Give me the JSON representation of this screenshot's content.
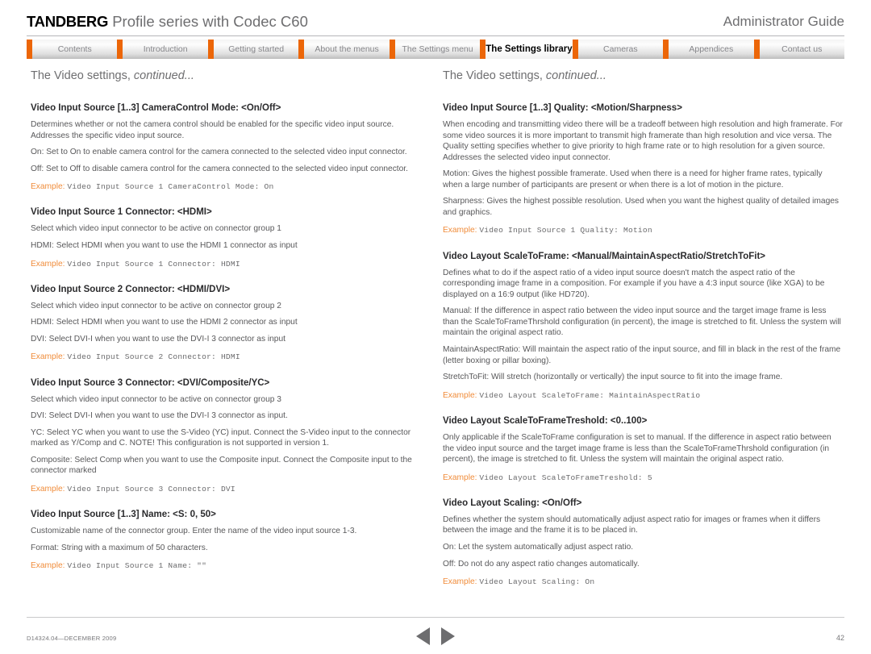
{
  "header": {
    "brand": "TANDBERG",
    "product": "Profile series with Codec C60",
    "guide_title": "Administrator Guide",
    "accent_color": "#ec6608"
  },
  "tabs": [
    {
      "label": "Contents",
      "active": false
    },
    {
      "label": "Introduction",
      "active": false
    },
    {
      "label": "Getting started",
      "active": false
    },
    {
      "label": "About the menus",
      "active": false
    },
    {
      "label": "The Settings menu",
      "active": false
    },
    {
      "label": "The Settings library",
      "active": true
    },
    {
      "label": "Cameras",
      "active": false
    },
    {
      "label": "Appendices",
      "active": false
    },
    {
      "label": "Contact us",
      "active": false
    }
  ],
  "left_column": {
    "title_main": "The Video settings,",
    "title_cont": "continued...",
    "sections": [
      {
        "heading": "Video Input Source [1..3] CameraControl Mode: <On/Off>",
        "paragraphs": [
          "Determines whether or not the camera control should be enabled for the specific video input source. Addresses the specific video input source.",
          "On: Set to On to enable camera control for the camera connected to the selected video input connector.",
          "Off: Set to Off to disable camera control for the camera connected to the selected video input connector."
        ],
        "example_label": "Example:",
        "example_code": "Video Input Source 1 CameraControl Mode: On"
      },
      {
        "heading": "Video Input Source 1 Connector: <HDMI>",
        "paragraphs": [
          "Select which video input connector to be active on connector group 1",
          "HDMI: Select HDMI when you want to use the HDMI 1 connector as input"
        ],
        "example_label": "Example:",
        "example_code": "Video Input Source 1 Connector: HDMI"
      },
      {
        "heading": "Video Input Source 2 Connector: <HDMI/DVI>",
        "paragraphs": [
          "Select which video input connector to be active on connector group 2",
          "HDMI: Select HDMI when you want to use the HDMI 2 connector as input",
          "DVI: Select DVI-I when you want to use the DVI-I 3 connector as input"
        ],
        "example_label": "Example:",
        "example_code": "Video Input Source 2 Connector: HDMI"
      },
      {
        "heading": "Video Input Source 3 Connector: <DVI/Composite/YC>",
        "paragraphs": [
          "Select which video input connector to be active on connector group 3",
          "DVI: Select DVI-I when you want to use the DVI-I 3 connector as input.",
          "YC: Select YC when you want to use the S-Video (YC) input. Connect the S-Video input to the connector marked as Y/Comp and C. NOTE! This configuration is not supported in version 1.",
          "Composite: Select Comp when you want to use the Composite input. Connect the Composite input to the connector marked"
        ],
        "example_label": "Example:",
        "example_code": "Video Input Source 3 Connector: DVI"
      },
      {
        "heading": "Video Input Source [1..3] Name: <S: 0, 50>",
        "paragraphs": [
          "Customizable name of the connector group. Enter the name of the video input source 1-3.",
          "Format: String with a maximum of 50 characters."
        ],
        "example_label": "Example:",
        "example_code": "Video Input Source 1 Name: \"\""
      }
    ]
  },
  "right_column": {
    "title_main": "The Video settings,",
    "title_cont": "continued...",
    "sections": [
      {
        "heading": "Video Input Source [1..3] Quality: <Motion/Sharpness>",
        "paragraphs": [
          "When encoding and transmitting video there will be a tradeoff between high resolution and high framerate. For some video sources it is more important to transmit high framerate than high resolution and vice versa. The Quality setting specifies whether to give priority to high frame rate or to high resolution for a given source. Addresses the selected video input connector.",
          "Motion: Gives the highest possible framerate. Used when there is a need for higher frame rates, typically when a large number of participants are present or when there is a lot of motion in the picture.",
          "Sharpness: Gives the highest possible resolution. Used when you want the highest quality of detailed images and graphics."
        ],
        "example_label": "Example:",
        "example_code": "Video Input Source 1 Quality: Motion"
      },
      {
        "heading": "Video Layout ScaleToFrame: <Manual/MaintainAspectRatio/StretchToFit>",
        "paragraphs": [
          "Defines what to do if the aspect ratio of a video input source doesn't match the aspect ratio of the corresponding image frame in a composition. For example if you have a 4:3 input source (like XGA) to be displayed on a 16:9 output (like HD720).",
          "Manual: If the difference in aspect ratio between the video input source and the target image frame is less than the ScaleToFrameThrshold configuration (in percent), the image is stretched to fit. Unless the system will maintain the original aspect ratio.",
          "MaintainAspectRatio: Will maintain the aspect ratio of the input source, and fill in black in the rest of the frame (letter boxing or pillar boxing).",
          "StretchToFit: Will stretch (horizontally or vertically) the input source to fit into the image frame."
        ],
        "example_label": "Example:",
        "example_code": "Video Layout ScaleToFrame: MaintainAspectRatio"
      },
      {
        "heading": "Video Layout ScaleToFrameTreshold: <0..100>",
        "paragraphs": [
          "Only applicable if the ScaleToFrame configuration is set to manual. If the difference in aspect ratio between the video input source and the target image frame is less than the ScaleToFrameThrshold configuration (in percent), the image is stretched to fit. Unless the system will maintain the original aspect ratio."
        ],
        "example_label": "Example:",
        "example_code": "Video Layout ScaleToFrameTreshold: 5"
      },
      {
        "heading": "Video Layout Scaling: <On/Off>",
        "paragraphs": [
          "Defines whether the system should automatically adjust aspect ratio for images or frames when it differs between the image and the frame it is to be placed in.",
          "On: Let the system automatically adjust aspect ratio.",
          "Off: Do not do any aspect ratio changes automatically."
        ],
        "example_label": "Example:",
        "example_code": "Video Layout Scaling: On"
      }
    ]
  },
  "footer": {
    "doc_id": "D14324.04—DECEMBER 2009",
    "prev_label": "previous page",
    "next_label": "next page",
    "page_number": "42"
  }
}
